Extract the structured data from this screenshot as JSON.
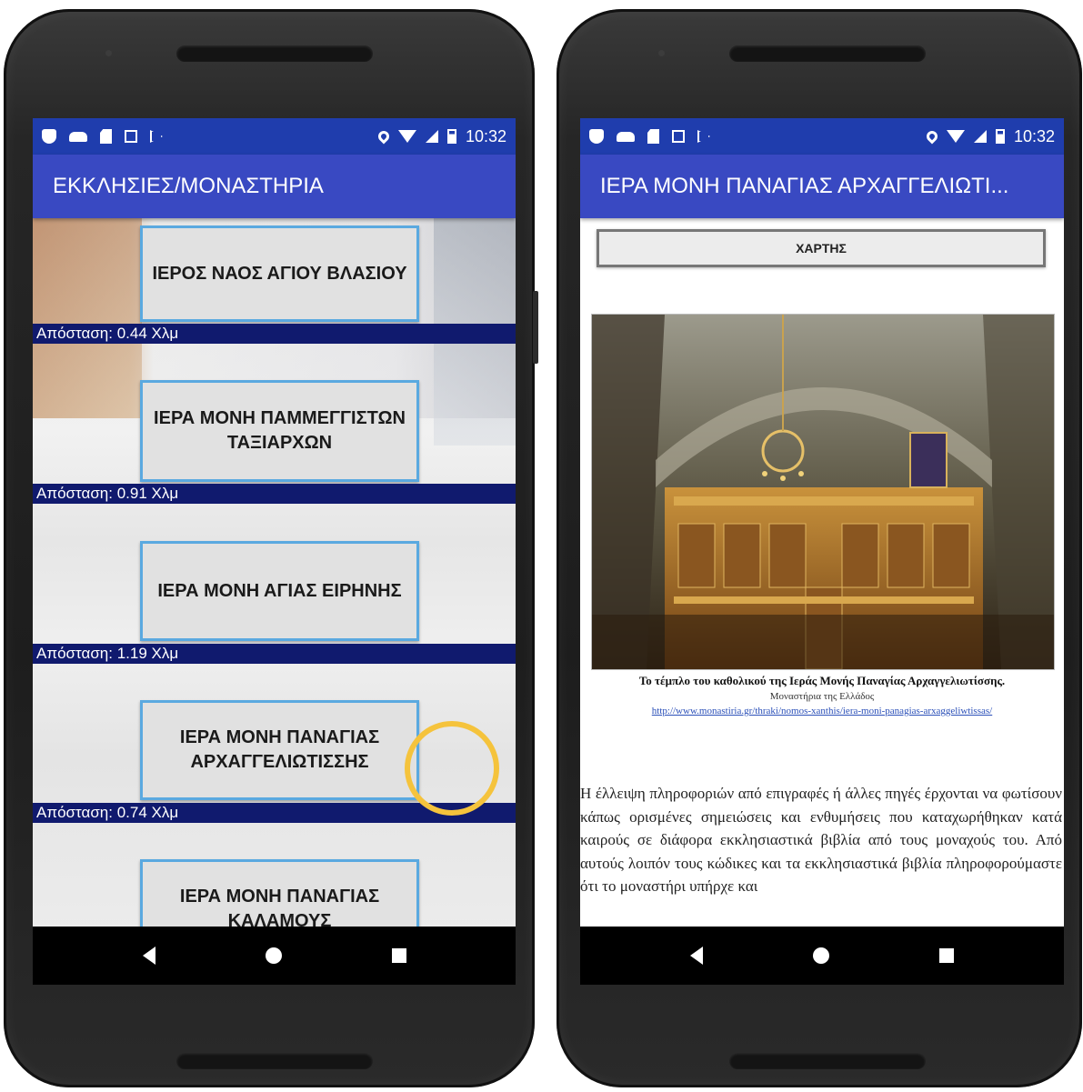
{
  "status_bar": {
    "time": "10:32"
  },
  "list_screen": {
    "title": "ΕΚΚΛΗΣΙΕΣ/ΜΟΝΑΣΤΗΡΙΑ",
    "items": [
      {
        "name": "ΙΕΡΟΣ ΝΑΟΣ ΑΓΙΟΥ ΒΛΑΣΙΟΥ",
        "distance": "Απόσταση: 0.44 Χλμ"
      },
      {
        "name": "ΙΕΡΑ ΜΟΝΗ ΠΑΜΜΕΓΓΙΣΤΩΝ ΤΑΞΙΑΡΧΩΝ",
        "distance": "Απόσταση: 0.91 Χλμ"
      },
      {
        "name": "ΙΕΡΑ ΜΟΝΗ ΑΓΙΑΣ ΕΙΡΗΝΗΣ",
        "distance": "Απόσταση: 1.19 Χλμ"
      },
      {
        "name": "ΙΕΡΑ ΜΟΝΗ ΠΑΝΑΓΙΑΣ ΑΡΧΑΓΓΕΛΙΩΤΙΣΣΗΣ",
        "distance": "Απόσταση: 0.74 Χλμ"
      },
      {
        "name": "ΙΕΡΑ ΜΟΝΗ ΠΑΝΑΓΙΑΣ ΚΑΛΑΜΟΥΣ",
        "distance": ""
      }
    ]
  },
  "detail_screen": {
    "title": "ΙΕΡΑ ΜΟΝΗ ΠΑΝΑΓΙΑΣ ΑΡΧΑΓΓΕΛΙΩΤΙ...",
    "map_button": "ΧΑΡΤΗΣ",
    "caption_title": "Το τέμπλο του καθολικού της Ιεράς Μονής Παναγίας Αρχαγγελιωτίσσης.",
    "caption_source": "Μοναστήρια της Ελλάδος",
    "caption_link": "http://www.monastiria.gr/thraki/nomos-xanthis/iera-moni-panagias-arxaggeliwtissas/",
    "body": "Η έλλειψη πληροφοριών από επιγραφές ή άλλες πηγές έρχονται να φωτίσουν κάπως ορισμένες σημειώσεις και ενθυμήσεις που καταχωρήθηκαν κατά καιρούς σε διάφορα εκκλησιαστικά βιβλία από τους μοναχούς του. Από αυτούς λοιπόν τους κώδικες και τα εκκλησιαστικά βιβλία πληροφορούμαστε ότι το μοναστήρι υπήρχε και"
  },
  "colors": {
    "status_bar": "#1f3dad",
    "app_bar": "#3949c2",
    "distance_bar": "#101a6e",
    "button_border": "#5aa9e0",
    "highlight_ring": "#f5c33c"
  },
  "icons": [
    "shield-icon",
    "cloud-icon",
    "sd-card-icon",
    "image-icon",
    "play-icon",
    "location-icon",
    "wifi-icon",
    "signal-icon",
    "battery-icon",
    "back-icon",
    "home-icon",
    "recents-icon"
  ]
}
